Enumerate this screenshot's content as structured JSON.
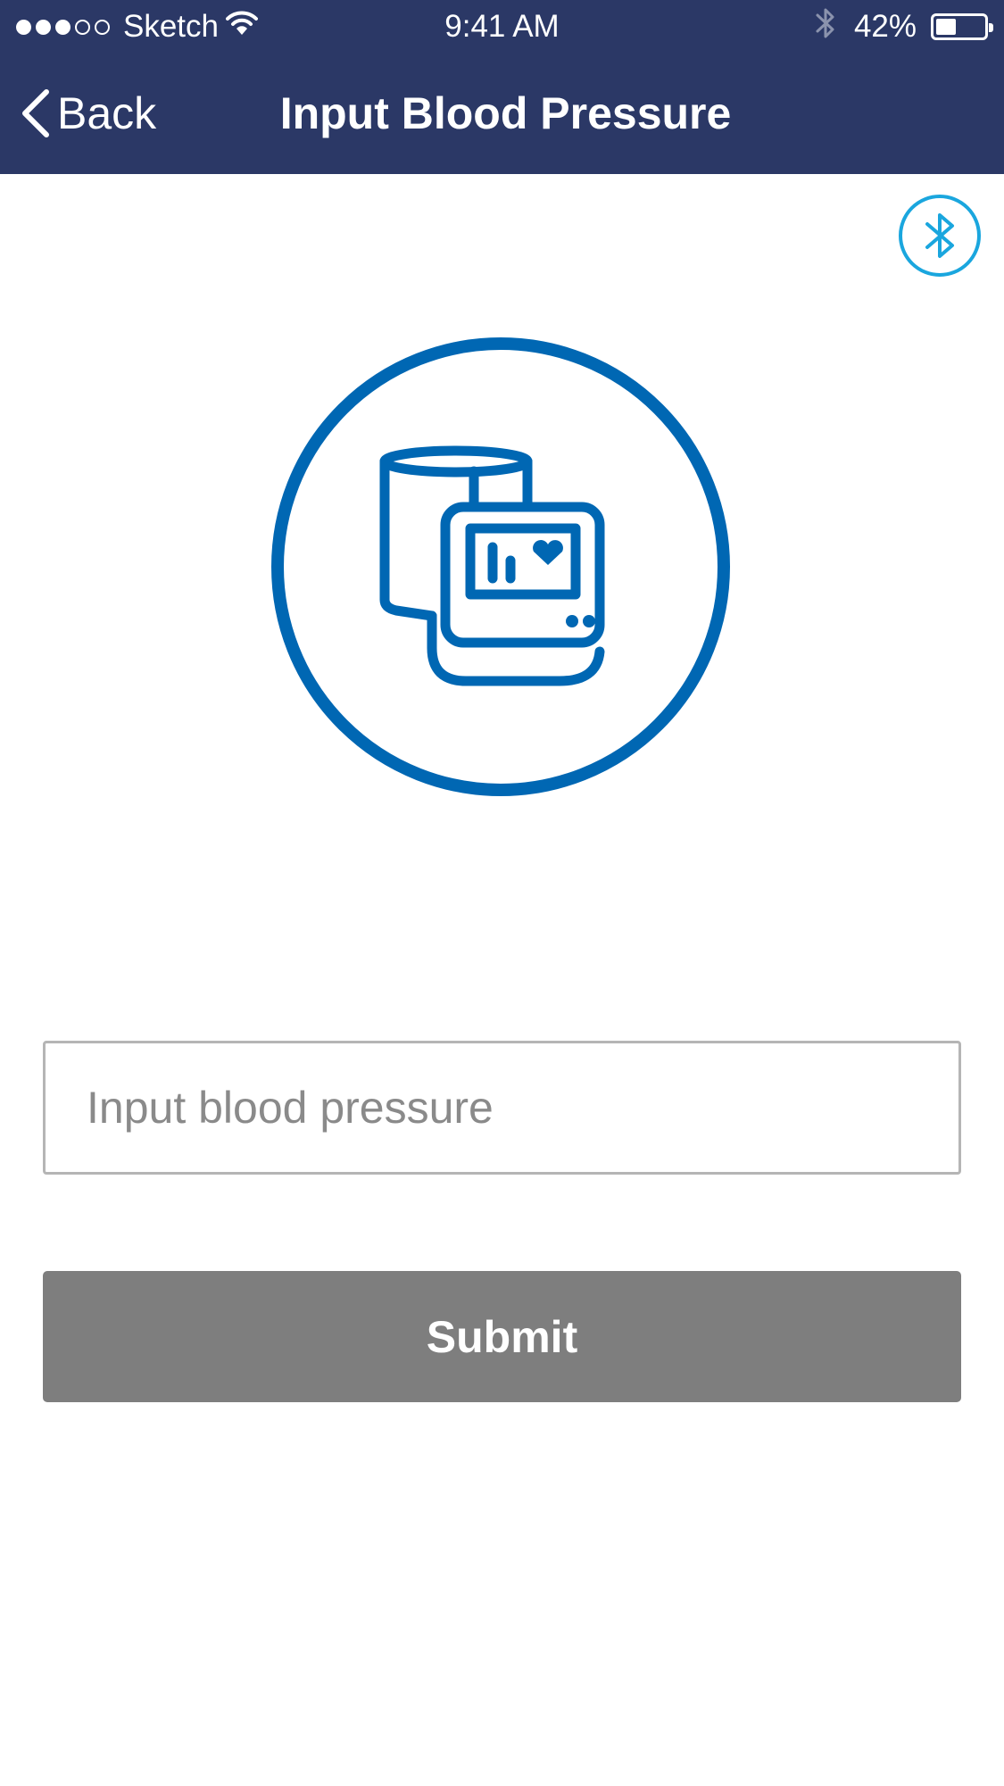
{
  "status_bar": {
    "carrier": "Sketch",
    "time": "9:41 AM",
    "battery_percent": "42%",
    "battery_level": 0.42,
    "signal_bars_filled": 3,
    "signal_bars_total": 5
  },
  "nav": {
    "back_label": "Back",
    "title": "Input Blood Pressure"
  },
  "form": {
    "input_placeholder": "Input blood pressure",
    "input_value": "",
    "submit_label": "Submit"
  },
  "icons": {
    "back": "chevron-left-icon",
    "bluetooth": "bluetooth-icon",
    "illustration": "blood-pressure-monitor-icon"
  },
  "colors": {
    "header_bg": "#2b3866",
    "illustration_blue": "#0067b3",
    "bluetooth_accent": "#1aa6de",
    "submit_bg": "#7e7e7e",
    "input_border": "#b5b5b5",
    "placeholder": "#8a8a8a"
  }
}
